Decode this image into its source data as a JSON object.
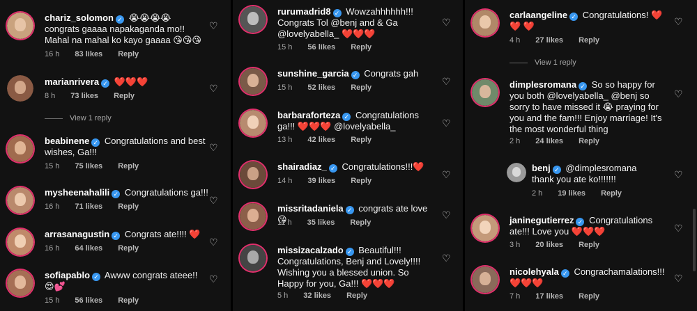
{
  "columns": [
    {
      "comments": [
        {
          "user": "chariz_solomon",
          "text": "😭😭😭😭 congrats gaaaa napakaganda mo!! Mahal na mahal ko kayo gaaaa 😘😘😘",
          "time": "16 h",
          "likes": "83 likes",
          "reply": "Reply",
          "avatar": "#c9a27e"
        },
        {
          "user": "marianrivera",
          "text": "❤️❤️❤️",
          "time": "8 h",
          "likes": "73 likes",
          "reply": "Reply",
          "avatar": "#8a5a44",
          "view": "View 1 reply"
        },
        {
          "user": "beabinene",
          "text": "Congratulations and best wishes, Ga!!!",
          "time": "15 h",
          "likes": "75 likes",
          "reply": "Reply",
          "avatar": "#a06b4e"
        },
        {
          "user": "mysheenahalili",
          "text": "Congratulations ga!!!",
          "time": "16 h",
          "likes": "71 likes",
          "reply": "Reply",
          "avatar": "#b9896c"
        },
        {
          "user": "arrasanagustin",
          "text": "Congrats ate!!!! ❤️",
          "time": "16 h",
          "likes": "64 likes",
          "reply": "Reply",
          "avatar": "#c08a6a"
        },
        {
          "user": "sofiapablo",
          "text": "Awww congrats ateee!! 😍💕",
          "time": "15 h",
          "likes": "56 likes",
          "reply": "Reply",
          "avatar": "#a66f55"
        }
      ]
    },
    {
      "comments": [
        {
          "user": "rurumadrid8",
          "text": "Wowzahhhhhh!!! Congrats Tol @benj  and & Ga @lovelyabella_ ❤️❤️❤️",
          "time": "15 h",
          "likes": "56 likes",
          "reply": "Reply",
          "avatar": "#555555"
        },
        {
          "user": "sunshine_garcia",
          "text": "Congrats gah",
          "time": "15 h",
          "likes": "52 likes",
          "reply": "Reply",
          "avatar": "#7a5a48"
        },
        {
          "user": "barbaraforteza",
          "text": "Congratulations ga!!! ❤️❤️❤️ @lovelyabella_",
          "time": "13 h",
          "likes": "42 likes",
          "reply": "Reply",
          "avatar": "#b78b6f"
        },
        {
          "user": "shairadiaz_",
          "text": "Congratulations!!!❤️",
          "time": "14 h",
          "likes": "39 likes",
          "reply": "Reply",
          "avatar": "#6b4a3a"
        },
        {
          "user": "missritadaniela",
          "text": "congrats ate love😘",
          "time": "11 h",
          "likes": "35 likes",
          "reply": "Reply",
          "avatar": "#8c5f4a"
        },
        {
          "user": "missizacalzado",
          "text": "Beautiful!!! Congratulations, Benj and Lovely!!!! Wishing you a blessed union. So Happy for you, Ga!!! ❤️❤️❤️",
          "time": "5 h",
          "likes": "32 likes",
          "reply": "Reply",
          "avatar": "#444444"
        }
      ]
    },
    {
      "comments": [
        {
          "user": "carlaangeline",
          "text": "Congratulations! ❤️❤️ ❤️",
          "time": "4 h",
          "likes": "27 likes",
          "reply": "Reply",
          "avatar": "#b08868",
          "view": "View 1 reply"
        },
        {
          "user": "dimplesromana",
          "text": "So so happy for you both @lovelyabella_ @benj so sorry to have missed it 😭 praying for you and the fam!!! Enjoy marriage! It's the most wonderful thing",
          "time": "2 h",
          "likes": "24 likes",
          "reply": "Reply",
          "avatar": "#6f8a6a"
        },
        {
          "user": "benj",
          "text": "@dimplesromana thank you ate ko!!!!!!!",
          "time": "2 h",
          "likes": "19 likes",
          "reply": "Reply",
          "avatar": "#9a9a9a",
          "nested": true
        },
        {
          "user": "janinegutierrez",
          "text": "Congratulations ate!!! Love you ❤️❤️❤️",
          "time": "3 h",
          "likes": "20 likes",
          "reply": "Reply",
          "avatar": "#c49a7a"
        },
        {
          "user": "nicolehyala",
          "text": "Congrachamalations!!! ❤️❤️❤️",
          "time": "7 h",
          "likes": "17 likes",
          "reply": "Reply",
          "avatar": "#8a6a5a"
        }
      ]
    }
  ],
  "colors": {
    "background": "#121212",
    "verified": "#3897f0",
    "ring": "#e1306c",
    "meta": "#a8a8a8"
  },
  "icons": {
    "like": "heart-outline-icon",
    "verified": "verified-badge-icon"
  },
  "verified_mark": "✓",
  "like_glyph": "♡"
}
